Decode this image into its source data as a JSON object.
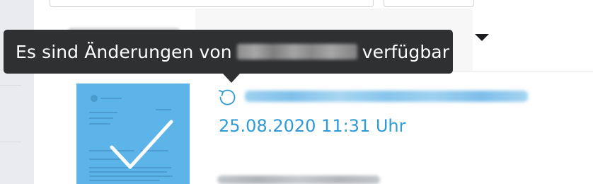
{
  "tooltip": {
    "prefix": "Es sind Änderungen von",
    "redacted_name": "",
    "suffix": "verfügbar"
  },
  "document": {
    "title": "",
    "datetime": "25.08.2020 11:31 Uhr",
    "status": "selected"
  },
  "icons": {
    "refresh": "refresh-icon",
    "check": "checkmark-icon",
    "dropdown": "caret-down-icon"
  },
  "colors": {
    "accent": "#2e9ad6",
    "thumbnail": "#5db4e8",
    "tooltip_bg": "#2f3032"
  }
}
